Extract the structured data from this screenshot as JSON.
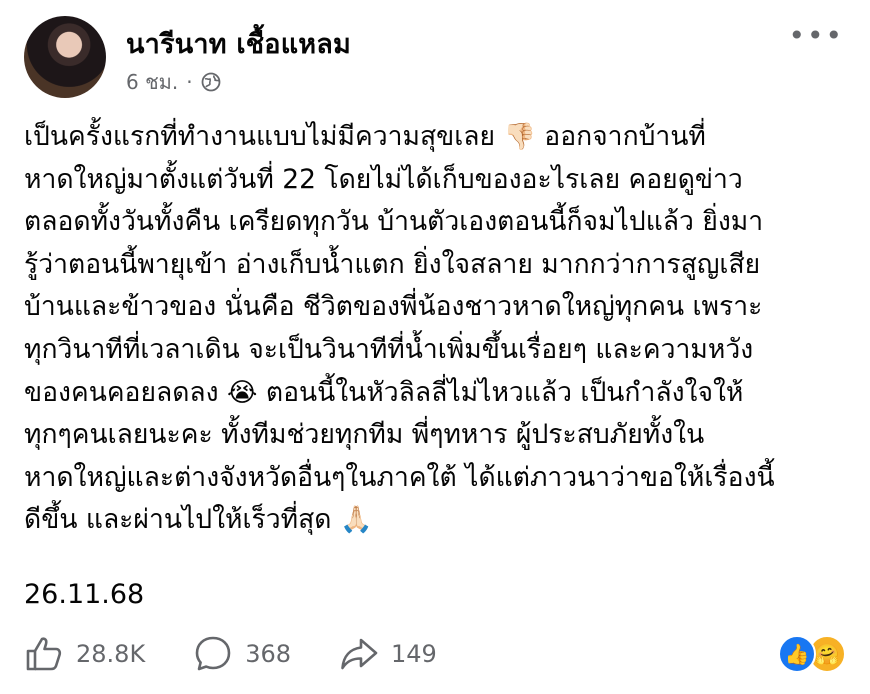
{
  "post": {
    "author": "นารีนาท เชื้อแหลม",
    "time": "6 ชม.",
    "separator": "·",
    "privacy_icon": "globe-icon",
    "more_icon": "more-horizontal-icon",
    "more_label": "•••",
    "message": {
      "line1a": "เป็นครั้งแรกที่ทำงานแบบไม่มีความสุขเลย ",
      "emoji1": "👎🏻",
      "line1b": " ออกจากบ้านที่\nหาดใหญ่มาตั้งแต่วันที่ 22 โดยไม่ได้เก็บของอะไรเลย คอยดูข่าว\nตลอดทั้งวันทั้งคืน เครียดทุกวัน บ้านตัวเองตอนนี้ก็จมไปแล้ว ยิ่งมา\nรู้ว่าตอนนี้พายุเข้า อ่างเก็บน้ำแตก ยิ่งใจสลาย มากกว่าการสูญเสีย\nบ้านและข้าวของ นั่นคือ ชีวิตของพี่น้องชาวหาดใหญ่ทุกคน เพราะ\nทุกวินาทีที่เวลาเดิน จะเป็นวินาทีที่น้ำเพิ่มขึ้นเรื่อยๆ และความหวัง\nของคนคอยลดลง ",
      "emoji2": "😭",
      "line2": " ตอนนี้ในหัวลิลลี่ไม่ไหวแล้ว เป็นกำลังใจให้\nทุกๆคนเลยนะคะ ทั้งทีมช่วยทุกทีม พี่ๆทหาร ผู้ประสบภัยทั้งใน\nหาดใหญ่และต่างจังหวัดอื่นๆในภาคใต้ ได้แต่ภาวนาว่าขอให้เรื่องนี้\nดีขึ้น และผ่านไปให้เร็วที่สุด ",
      "emoji3": "🙏🏻"
    },
    "date": "26.11.68"
  },
  "footer": {
    "likes": "28.8K",
    "comments": "368",
    "shares": "149",
    "reactions": [
      "like",
      "care"
    ],
    "like_glyph": "👍",
    "care_glyph": "🤗"
  },
  "colors": {
    "text": "#050505",
    "secondary": "#65676b",
    "like_blue": "#1877f2",
    "care_yellow": "#f7b125"
  }
}
